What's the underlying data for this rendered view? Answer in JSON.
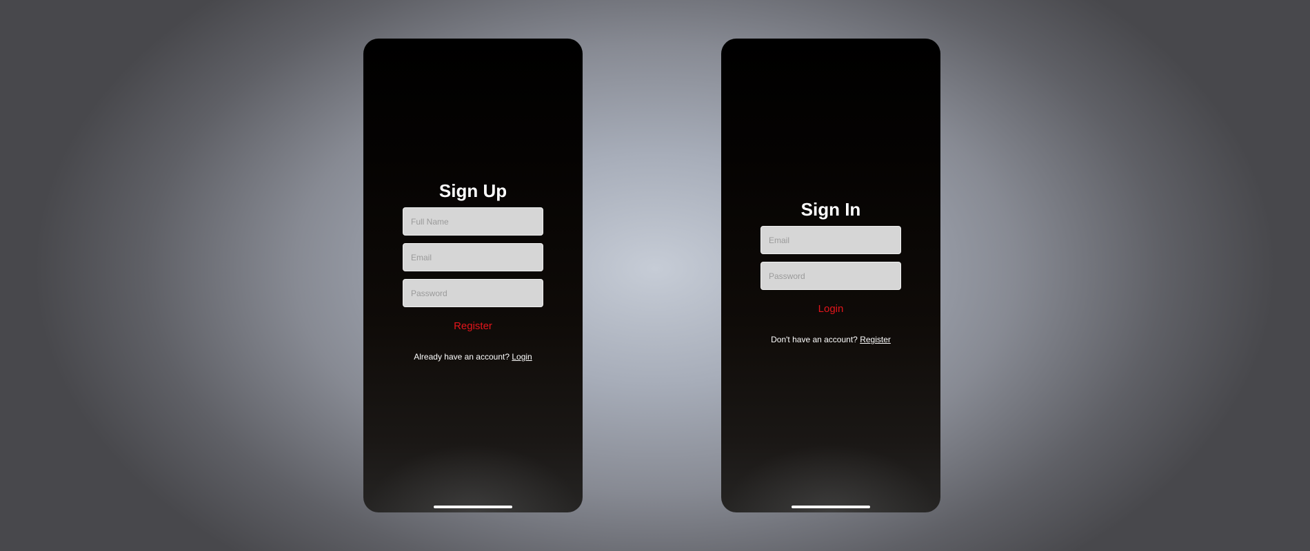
{
  "colors": {
    "accent": "#e5151b",
    "text": "#ffffff",
    "field_background": "#d6d6d6"
  },
  "signup": {
    "title": "Sign Up",
    "full_name_placeholder": "Full Name",
    "email_placeholder": "Email",
    "password_placeholder": "Password",
    "register_label": "Register",
    "switch_prompt": "Already have an account?",
    "switch_link": "Login"
  },
  "signin": {
    "title": "Sign In",
    "email_placeholder": "Email",
    "password_placeholder": "Password",
    "login_label": "Login",
    "switch_prompt": "Don't have an account?",
    "switch_link": "Register"
  }
}
